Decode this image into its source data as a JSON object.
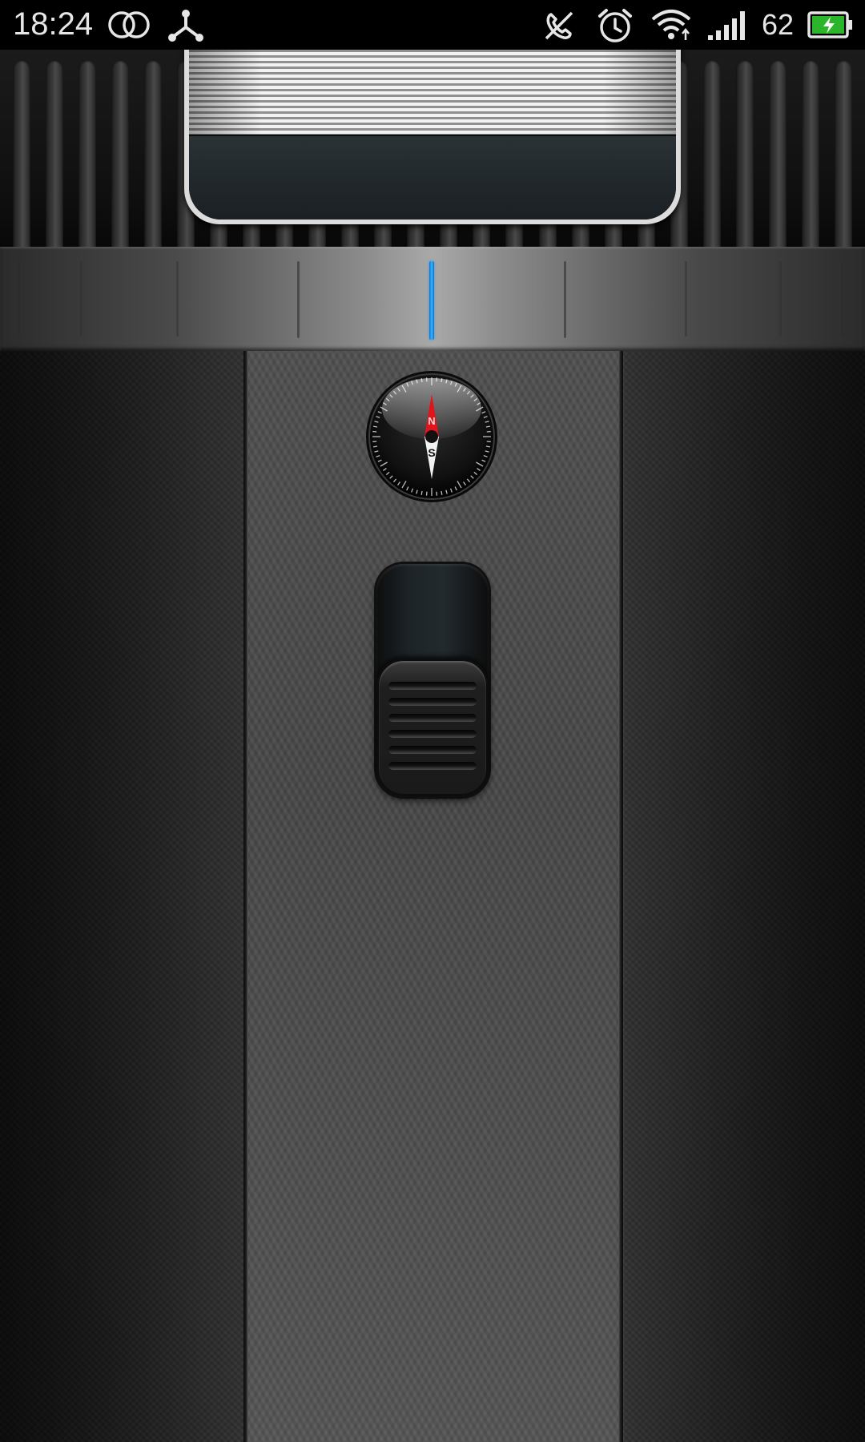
{
  "status_bar": {
    "time": "18:24",
    "battery_level": "62",
    "left_icons": [
      "dual-sim-rings-icon",
      "share-hub-icon"
    ],
    "right_icons": [
      "no-call-icon",
      "alarm-clock-icon",
      "wifi-icon",
      "cellular-signal-icon",
      "battery-charging-icon"
    ],
    "battery_fill_color": "#2bb52b"
  },
  "flashlight": {
    "scale_active_color": "#1e90ff",
    "compass": {
      "north_label": "N",
      "south_label": "S",
      "needle_north_color": "#e0141a",
      "needle_south_color": "#f2f2f2"
    },
    "power_switch": {
      "state": "off"
    }
  }
}
